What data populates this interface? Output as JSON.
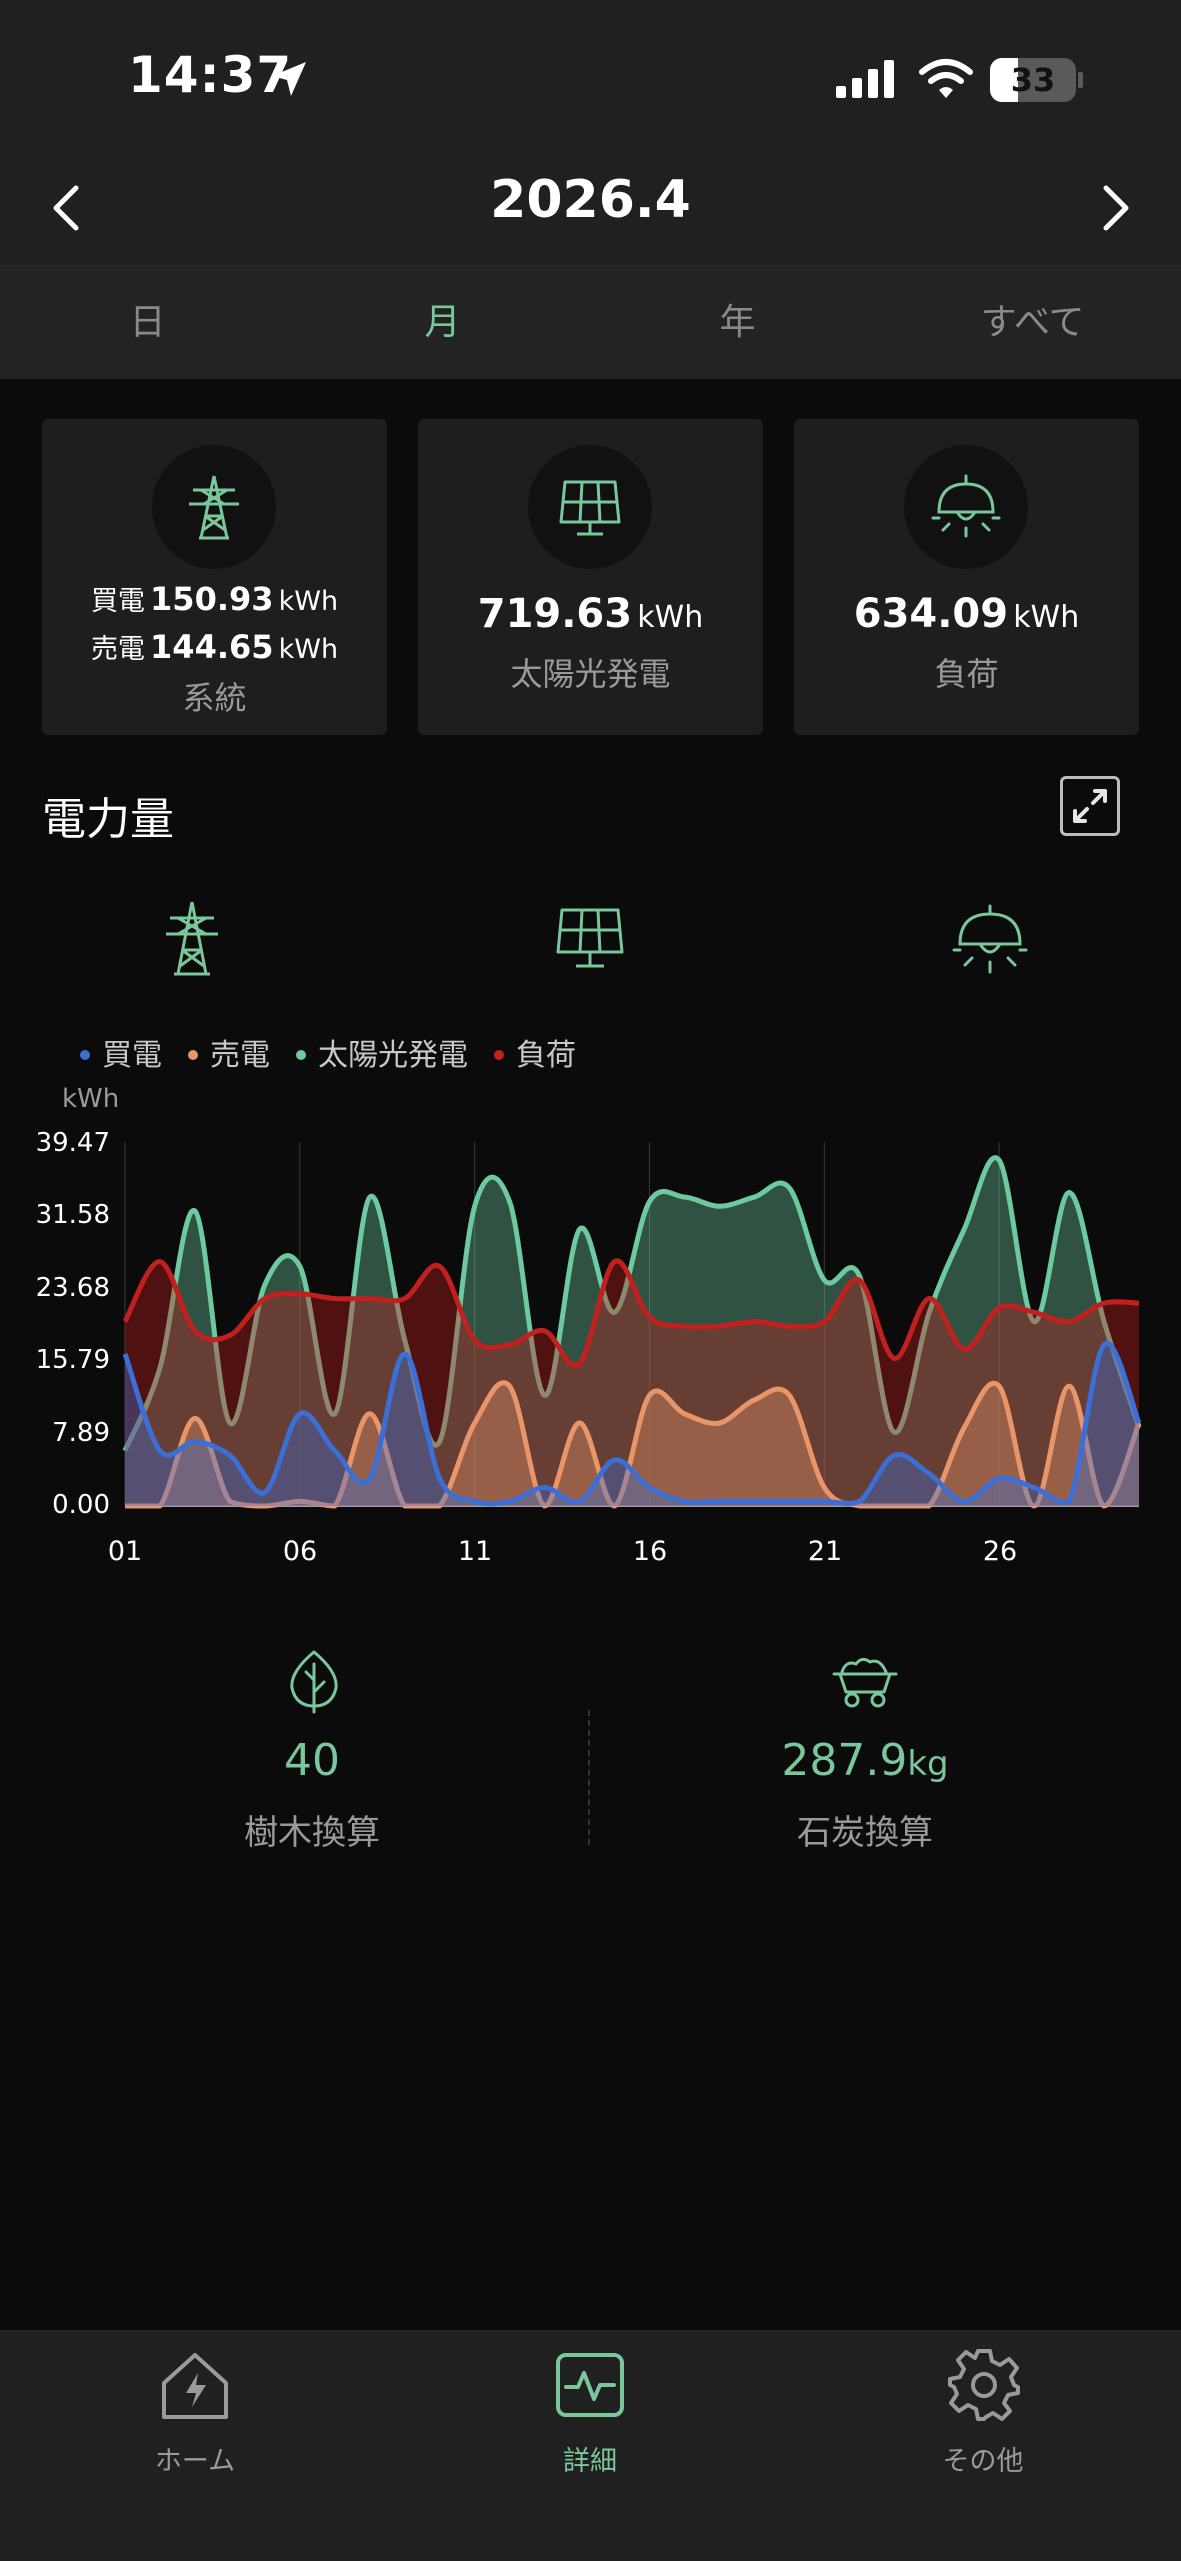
{
  "status_bar": {
    "time": "14:37",
    "battery": "33"
  },
  "header": {
    "title": "2026.4",
    "prev_label": "previous",
    "next_label": "next"
  },
  "tabs": [
    {
      "label": "日",
      "active": false
    },
    {
      "label": "月",
      "active": true
    },
    {
      "label": "年",
      "active": false
    },
    {
      "label": "すべて",
      "active": false
    }
  ],
  "cards": {
    "grid": {
      "buy_label": "買電",
      "buy_value": "150.93",
      "sell_label": "売電",
      "sell_value": "144.65",
      "unit": "kWh",
      "caption": "系統"
    },
    "solar": {
      "value": "719.63",
      "unit": "kWh",
      "caption": "太陽光発電"
    },
    "load": {
      "value": "634.09",
      "unit": "kWh",
      "caption": "負荷"
    }
  },
  "section": {
    "title": "電力量"
  },
  "colors": {
    "accent": "#79c79a",
    "buy": "#3b6fd6",
    "sell": "#e8956a",
    "solar": "#6cc9a0",
    "load": "#c2201e"
  },
  "chart_data": {
    "type": "area",
    "ylabel": "kWh",
    "y_ticks": [
      "39.47",
      "31.58",
      "23.68",
      "15.79",
      "7.89",
      "0.00"
    ],
    "ylim": [
      0,
      39.47
    ],
    "x_ticks": [
      "01",
      "06",
      "11",
      "16",
      "21",
      "26"
    ],
    "x": [
      1,
      2,
      3,
      4,
      5,
      6,
      7,
      8,
      9,
      10,
      11,
      12,
      13,
      14,
      15,
      16,
      17,
      18,
      19,
      20,
      21,
      22,
      23,
      24,
      25,
      26,
      27,
      28,
      29,
      30
    ],
    "legend": [
      "買電",
      "売電",
      "太陽光発電",
      "負荷"
    ],
    "series": [
      {
        "name": "買電",
        "color": "#3b6fd6",
        "values": [
          16.5,
          6,
          7,
          5.5,
          1.5,
          10,
          6,
          3,
          16.5,
          3,
          0.5,
          0.5,
          2,
          0.5,
          5,
          2,
          0.5,
          0.5,
          0.5,
          0.5,
          0.5,
          0.5,
          5.5,
          3.5,
          0.5,
          3,
          2,
          0.5,
          17.5,
          9
        ]
      },
      {
        "name": "売電",
        "color": "#e8956a",
        "values": [
          0,
          0,
          9.5,
          0.5,
          0,
          0.5,
          0,
          10,
          0,
          0,
          9,
          13,
          0,
          9,
          0,
          12,
          10,
          9,
          11.5,
          12,
          2,
          0,
          0,
          0,
          8.5,
          13,
          0,
          13,
          0,
          9
        ]
      },
      {
        "name": "太陽光発電",
        "color": "#6cc9a0",
        "values": [
          6,
          15,
          32,
          9,
          24,
          26,
          10,
          33.5,
          18,
          7,
          32.5,
          33,
          12,
          30,
          21,
          33,
          33.5,
          32.5,
          33.5,
          34.5,
          24.5,
          25,
          8,
          21,
          30,
          37.5,
          20,
          34,
          20,
          8.5
        ]
      },
      {
        "name": "負荷",
        "color": "#c2201e",
        "values": [
          20,
          26.5,
          19,
          18.5,
          22.5,
          23,
          22.5,
          22.5,
          22.5,
          26,
          18,
          17.5,
          19,
          15.5,
          26.5,
          20.5,
          19.5,
          19.5,
          20,
          19.5,
          20,
          24.5,
          16,
          22.5,
          17,
          21.5,
          21,
          20,
          22,
          22
        ]
      }
    ]
  },
  "eco": {
    "trees": {
      "value": "40",
      "caption": "樹木換算"
    },
    "coal": {
      "value": "287.9",
      "unit": "kg",
      "caption": "石炭換算"
    }
  },
  "bottom_nav": [
    {
      "label": "ホーム",
      "active": false
    },
    {
      "label": "詳細",
      "active": true
    },
    {
      "label": "その他",
      "active": false
    }
  ]
}
